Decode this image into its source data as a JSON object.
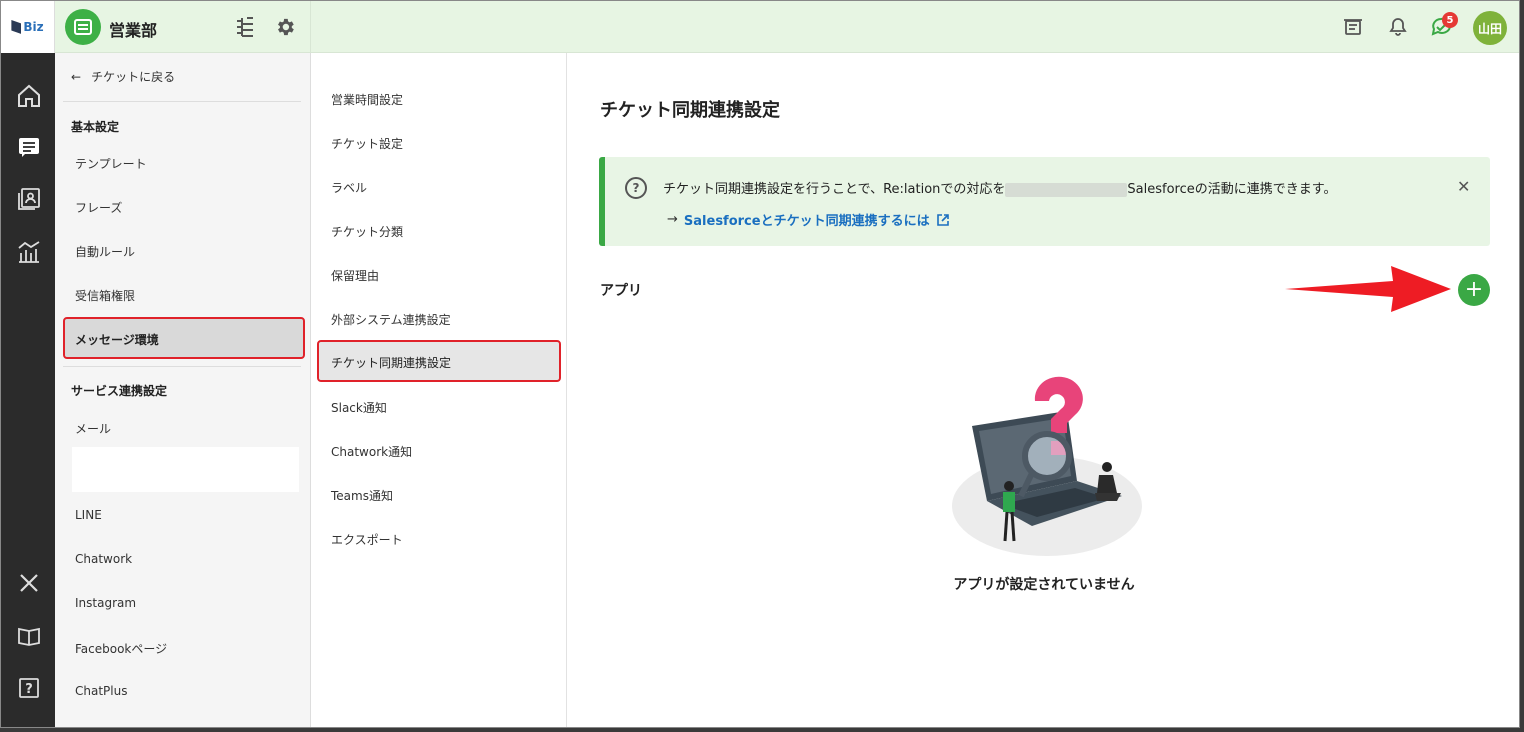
{
  "header": {
    "logo_text": "Biz",
    "department": "営業部",
    "avatar": "山田",
    "notification_count": "5"
  },
  "settings_nav": {
    "back": "チケットに戻る",
    "section_basic": "基本設定",
    "basic_items": [
      "テンプレート",
      "フレーズ",
      "自動ルール",
      "受信箱権限"
    ],
    "selected": "メッセージ環境",
    "section_service": "サービス連携設定",
    "service_items": [
      "メール",
      "LINE",
      "Chatwork",
      "Instagram",
      "Facebookページ",
      "ChatPlus"
    ]
  },
  "sub_nav": {
    "items_before": [
      "営業時間設定",
      "チケット設定",
      "ラベル",
      "チケット分類",
      "保留理由",
      "外部システム連携設定"
    ],
    "selected": "チケット同期連携設定",
    "items_after": [
      "Slack通知",
      "Chatwork通知",
      "Teams通知",
      "エクスポート"
    ]
  },
  "main": {
    "title": "チケット同期連携設定",
    "notice_text_before": "チケット同期連携設定を行うことで、Re:lationでの対応を",
    "notice_text_after": "Salesforceの活動に連携できます。",
    "notice_link": "Salesforceとチケット同期連携するには",
    "apps_heading": "アプリ",
    "empty_message": "アプリが設定されていません"
  },
  "colors": {
    "brand_green": "#3aa845",
    "highlight_red": "#e0222a",
    "link_blue": "#1a6fc0",
    "header_bg": "#e7f5e3",
    "rail_bg": "#2b2b2b"
  }
}
